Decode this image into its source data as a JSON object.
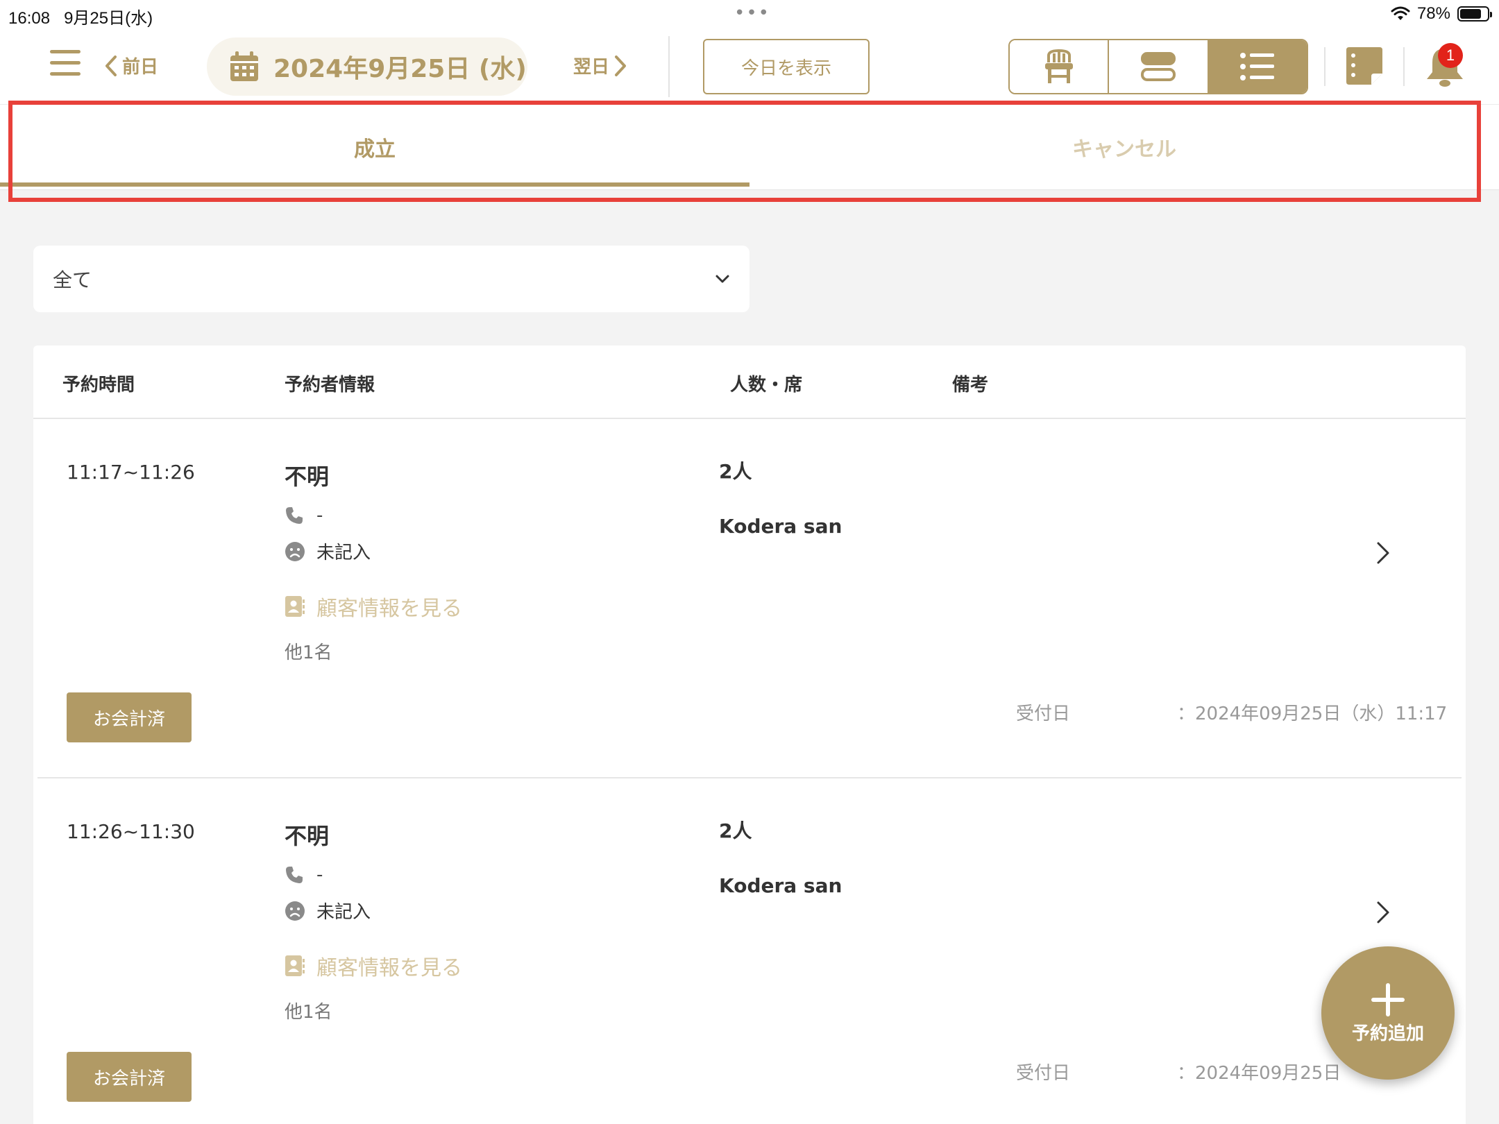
{
  "status_bar": {
    "time": "16:08",
    "date": "9月25日(水)",
    "battery": "78%"
  },
  "header": {
    "prev_label": "前日",
    "date": "2024年9月25日 (水)",
    "next_label": "翌日",
    "today_label": "今日を表示",
    "view_modes": [
      "seat-view-icon",
      "timeline-view-icon",
      "list-view-icon"
    ],
    "active_view": "list",
    "notification_count": "1"
  },
  "tabs": [
    {
      "label": "成立",
      "active": true
    },
    {
      "label": "キャンセル",
      "active": false
    }
  ],
  "filter": {
    "selected": "全て"
  },
  "table": {
    "columns": [
      "予約時間",
      "予約者情報",
      "人数・席",
      "備考"
    ],
    "rows": [
      {
        "time": "11:17~11:26",
        "name": "不明",
        "phone": "-",
        "status": "未記入",
        "customer_link": "顧客情報を見る",
        "others": "他1名",
        "people": "2人",
        "seat": "Kodera san",
        "notes": "",
        "badge": "お会計済",
        "received_label": "受付日",
        "received_value": "：2024年09月25日（水）11:17"
      },
      {
        "time": "11:26~11:30",
        "name": "不明",
        "phone": "-",
        "status": "未記入",
        "customer_link": "顧客情報を見る",
        "others": "他1名",
        "people": "2人",
        "seat": "Kodera san",
        "notes": "",
        "badge": "お会計済",
        "received_label": "受付日",
        "received_value": "：2024年09月25日"
      }
    ]
  },
  "fab": {
    "label": "予約追加"
  },
  "colors": {
    "accent": "#b19a65",
    "accent_light": "#d9ccae",
    "highlight": "#e8413a",
    "badge": "#e2231a"
  }
}
